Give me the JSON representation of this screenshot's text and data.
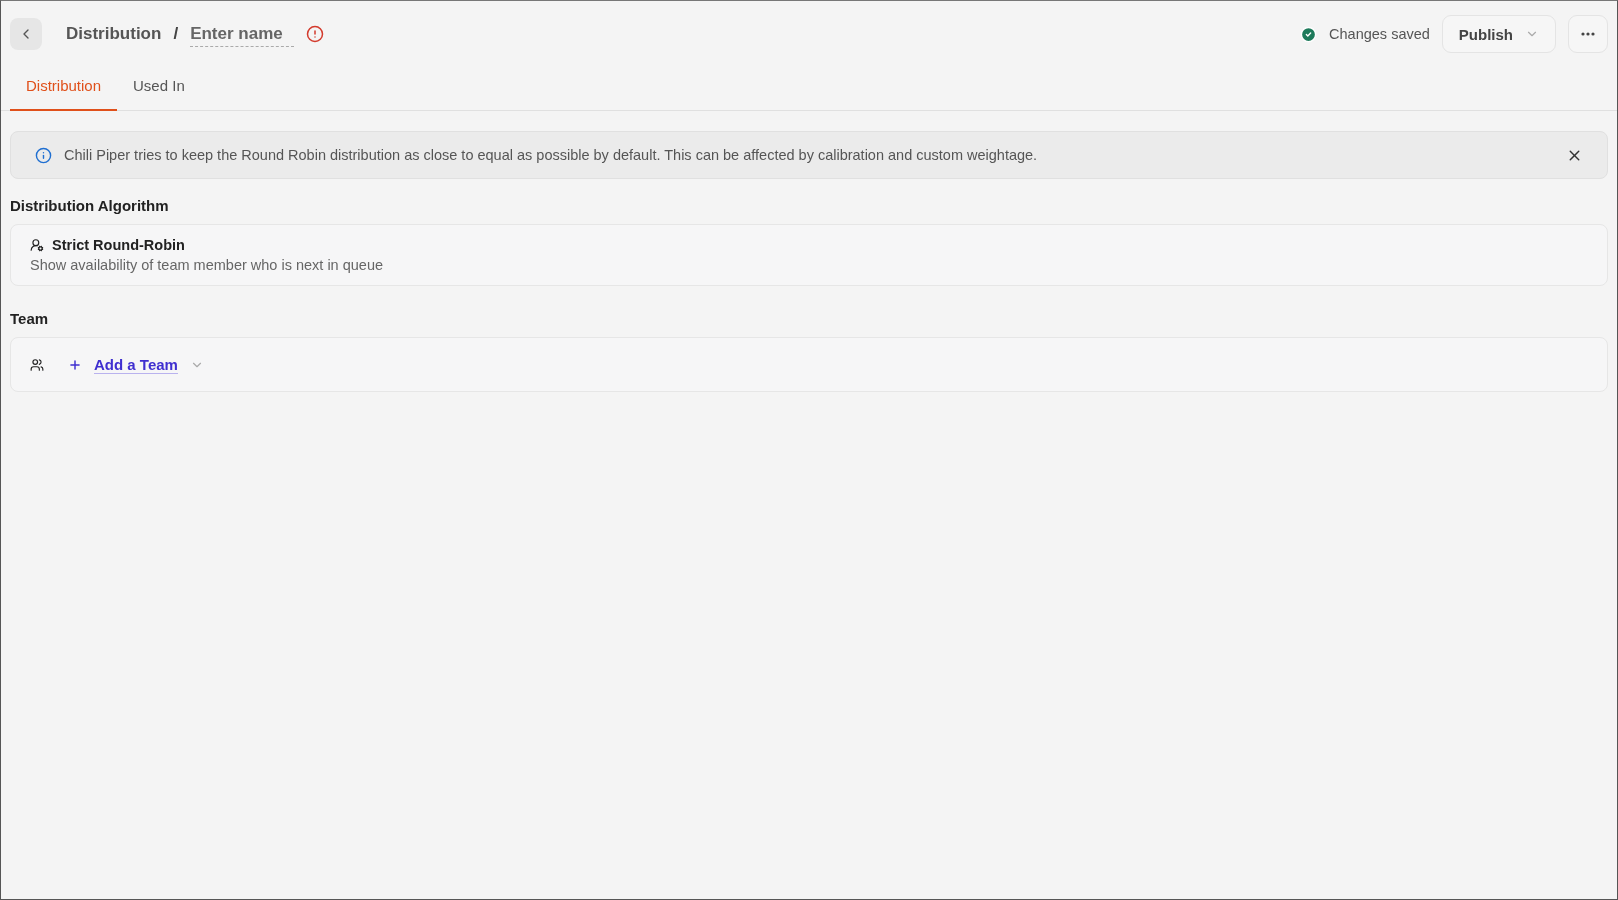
{
  "header": {
    "breadcrumb": "Distribution",
    "separator": "/",
    "name_field": {
      "placeholder": "Enter name"
    },
    "name_error": true,
    "save_status": "Changes saved",
    "publish": "Publish"
  },
  "tabs": [
    {
      "label": "Distribution",
      "selected": true
    },
    {
      "label": "Used In",
      "selected": false
    }
  ],
  "banner": {
    "text": "Chili Piper tries to keep the Round Robin distribution as close to equal as possible by default. This can be affected by calibration and custom weightage."
  },
  "algorithm": {
    "heading": "Distribution Algorithm",
    "title": "Strict Round-Robin",
    "description": "Show availability of team member who is next in queue"
  },
  "team": {
    "heading": "Team",
    "add_label": "Add a Team"
  }
}
